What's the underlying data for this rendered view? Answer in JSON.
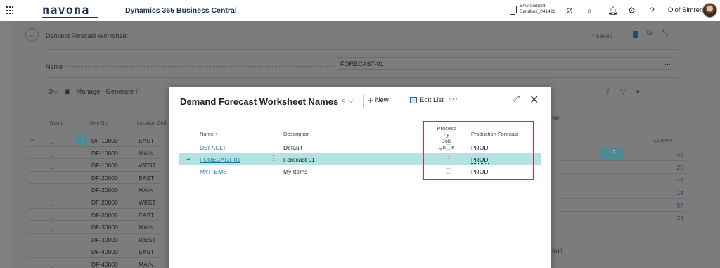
{
  "app": {
    "logo": "navona",
    "title": "Dynamics 365 Business Central",
    "environment_label": "Environment:",
    "environment_value": "Sandbox_041422",
    "user_name": "Olof Simren"
  },
  "page": {
    "title": "Demand Forecast Worksheet",
    "saved_label": "✓Saved",
    "name_label": "Name",
    "name_value": "FORECAST-01",
    "actions": [
      "Manage",
      "Generate F"
    ],
    "grid_headers": [
      "Warni...",
      "Item No.",
      "Location Cod"
    ],
    "rows": [
      {
        "item": "DF-10000",
        "loc": "EAST"
      },
      {
        "item": "DF-10000",
        "loc": "MAIN"
      },
      {
        "item": "DF-10000",
        "loc": "WEST"
      },
      {
        "item": "DF-20000",
        "loc": "EAST"
      },
      {
        "item": "DF-20000",
        "loc": "MAIN"
      },
      {
        "item": "DF-20000",
        "loc": "WEST"
      },
      {
        "item": "DF-30000",
        "loc": "EAST"
      },
      {
        "item": "DF-30000",
        "loc": "MAIN"
      },
      {
        "item": "DF-30000",
        "loc": "WEST"
      },
      {
        "item": "DF-40000",
        "loc": "EAST"
      },
      {
        "item": "DF-40000",
        "loc": "MAIN"
      }
    ],
    "right_section_top": "se",
    "quantity_header": "Quantity",
    "quantities": [
      "43",
      "26",
      "47",
      "14",
      "57",
      "24"
    ],
    "right_section_bottom": "sult"
  },
  "modal": {
    "title": "Demand Forecast Worksheet Names",
    "new_label": "New",
    "edit_list_label": "Edit List",
    "headers": {
      "name": "Name ↑",
      "description": "Description",
      "process_line1": "Process by",
      "process_line2": "Job Queue",
      "production_forecast": "Production Forecast"
    },
    "rows": [
      {
        "name": "DEFAULT",
        "description": "Default",
        "process": false,
        "forecast": "PROD"
      },
      {
        "name": "FORECAST-01",
        "description": "Forecast 01",
        "process": true,
        "forecast": "PROD"
      },
      {
        "name": "MYITEMS",
        "description": "My Items",
        "process": false,
        "forecast": "PROD"
      }
    ]
  }
}
